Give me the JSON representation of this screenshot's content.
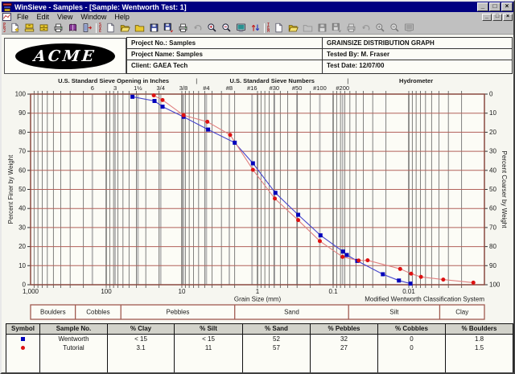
{
  "window": {
    "title": "WinSieve - Samples - [Sample: Wentworth Test: 1]",
    "controls": {
      "minimize": "_",
      "restore": "□",
      "close": "×"
    }
  },
  "menu": {
    "items": [
      "File",
      "Edit",
      "View",
      "Window",
      "Help"
    ]
  },
  "toolbar": {
    "groups": [
      {
        "label": "PRJ",
        "buttons": [
          {
            "icon": "new-project",
            "disabled": false
          },
          {
            "icon": "open-project",
            "disabled": false
          },
          {
            "icon": "save-project",
            "disabled": false
          },
          {
            "icon": "print",
            "disabled": false
          },
          {
            "icon": "help-book",
            "disabled": false
          },
          {
            "icon": "exit",
            "disabled": false
          }
        ]
      },
      {
        "label": "SVE",
        "buttons": [
          {
            "icon": "new-document",
            "disabled": false
          },
          {
            "icon": "open-folder",
            "disabled": false
          },
          {
            "icon": "closed-folder",
            "disabled": false
          },
          {
            "icon": "save",
            "disabled": false
          },
          {
            "icon": "save-as",
            "disabled": false
          },
          {
            "icon": "print",
            "disabled": false
          },
          {
            "icon": "undo",
            "disabled": true
          },
          {
            "icon": "zoom-in",
            "disabled": false
          },
          {
            "icon": "zoom-out",
            "disabled": false
          },
          {
            "icon": "print-preview",
            "disabled": false
          },
          {
            "icon": "sort",
            "disabled": false
          }
        ]
      },
      {
        "label": "TEM",
        "buttons": [
          {
            "icon": "new-document",
            "disabled": false
          },
          {
            "icon": "open-folder",
            "disabled": false
          },
          {
            "icon": "closed-folder",
            "disabled": true
          },
          {
            "icon": "save",
            "disabled": true
          },
          {
            "icon": "save-as",
            "disabled": true
          },
          {
            "icon": "print",
            "disabled": true
          },
          {
            "icon": "undo",
            "disabled": true
          },
          {
            "icon": "zoom-in",
            "disabled": true
          },
          {
            "icon": "zoom-out",
            "disabled": true
          },
          {
            "icon": "print-preview",
            "disabled": true
          }
        ]
      }
    ]
  },
  "header": {
    "logo_text": "ACME",
    "fields_left": [
      "Project No.: Samples",
      "Project Name: Samples",
      "Client: GAEA Tech"
    ],
    "fields_right": [
      "GRAINSIZE DISTRIBUTION GRAPH",
      "Tested By: M. Fraser",
      "Test Date: 12/07/00"
    ]
  },
  "chart_data": {
    "type": "line",
    "x_scale": "log",
    "x_axis_label": "Grain Size (mm)",
    "x_range_mm": [
      1000,
      0.001
    ],
    "x_tick_labels": [
      {
        "label": "1,000",
        "mm": 1000
      },
      {
        "label": "100",
        "mm": 100
      },
      {
        "label": "10",
        "mm": 10
      },
      {
        "label": "1",
        "mm": 1
      },
      {
        "label": "0.1",
        "mm": 0.1
      },
      {
        "label": "0.01",
        "mm": 0.01
      }
    ],
    "y_left_label": "Percent Finer by Weight",
    "y_right_label": "Percent Coarser by Weight",
    "y_ticks": [
      0,
      10,
      20,
      30,
      40,
      50,
      60,
      70,
      80,
      90,
      100
    ],
    "top_sections": [
      {
        "label": "U.S. Standard Sieve Opening in Inches",
        "from_mm": 1000,
        "to_mm": 6.4
      },
      {
        "label": "U.S. Standard Sieve Numbers",
        "from_mm": 6.4,
        "to_mm": 0.064
      },
      {
        "label": "Hydrometer",
        "from_mm": 0.064,
        "to_mm": 0.001
      }
    ],
    "sieve_ticks": [
      {
        "label": "6",
        "mm": 152.4
      },
      {
        "label": "3",
        "mm": 76.2
      },
      {
        "label": "1½",
        "mm": 38.1
      },
      {
        "label": "3/4",
        "mm": 19.05
      },
      {
        "label": "3/8",
        "mm": 9.53
      },
      {
        "label": "#4",
        "mm": 4.75
      },
      {
        "label": "#8",
        "mm": 2.36
      },
      {
        "label": "#16",
        "mm": 1.18
      },
      {
        "label": "#30",
        "mm": 0.6
      },
      {
        "label": "#50",
        "mm": 0.3
      },
      {
        "label": "#100",
        "mm": 0.15
      },
      {
        "label": "#200",
        "mm": 0.075
      }
    ],
    "footnote": "Modified Wentworth Classification System",
    "bands": [
      {
        "label": "Boulders",
        "from_mm": 1000,
        "to_mm": 256
      },
      {
        "label": "Cobbles",
        "from_mm": 256,
        "to_mm": 64
      },
      {
        "label": "Pebbles",
        "from_mm": 64,
        "to_mm": 2
      },
      {
        "label": "Sand",
        "from_mm": 2,
        "to_mm": 0.0625
      },
      {
        "label": "Silt",
        "from_mm": 0.0625,
        "to_mm": 0.0039
      },
      {
        "label": "Clay",
        "from_mm": 0.0039,
        "to_mm": 0.001
      }
    ],
    "grid": {
      "horizontal_color": "#b2615a",
      "vertical_color": "#4d4d4d",
      "box_color": "#8a4a40"
    },
    "series": [
      {
        "name": "Wentworth",
        "marker": "square",
        "color": "#0000bb",
        "line_color": "#4444cc",
        "points_mm_percentfiner": [
          [
            45,
            98.6
          ],
          [
            23,
            96.4
          ],
          [
            18,
            93.4
          ],
          [
            9.5,
            88.1
          ],
          [
            4.5,
            81.4
          ],
          [
            2.0,
            74.5
          ],
          [
            1.15,
            63.7
          ],
          [
            0.58,
            48.2
          ],
          [
            0.29,
            36.7
          ],
          [
            0.147,
            25.9
          ],
          [
            0.074,
            17.4
          ],
          [
            0.066,
            15.6
          ],
          [
            0.048,
            12.5
          ],
          [
            0.022,
            5.5
          ],
          [
            0.0135,
            2.2
          ],
          [
            0.0095,
            0.6
          ]
        ]
      },
      {
        "name": "Tutorial",
        "marker": "circle",
        "color": "#dd1111",
        "line_color": "#e08080",
        "points_mm_percentfiner": [
          [
            23.5,
            99.3
          ],
          [
            18,
            96.9
          ],
          [
            9.5,
            88.9
          ],
          [
            4.6,
            85.5
          ],
          [
            2.3,
            78.6
          ],
          [
            1.15,
            60.3
          ],
          [
            0.59,
            45.2
          ],
          [
            0.29,
            33.9
          ],
          [
            0.15,
            22.9
          ],
          [
            0.075,
            14.6
          ],
          [
            0.046,
            12.7
          ],
          [
            0.035,
            12.8
          ],
          [
            0.013,
            8.3
          ],
          [
            0.0093,
            5.8
          ],
          [
            0.0069,
            4.1
          ],
          [
            0.0035,
            2.7
          ],
          [
            0.0014,
            1.1
          ]
        ]
      }
    ]
  },
  "results_table": {
    "headers": [
      "Symbol",
      "Sample No.",
      "% Clay",
      "% Silt",
      "% Sand",
      "% Pebbles",
      "% Cobbles",
      "% Boulders"
    ],
    "rows": [
      {
        "symbol": {
          "shape": "square",
          "color": "#0000bb"
        },
        "sample": "Wentworth",
        "values": [
          "< 15",
          "< 15",
          "52",
          "32",
          "0",
          "1.8"
        ]
      },
      {
        "symbol": {
          "shape": "circle",
          "color": "#dd1111"
        },
        "sample": "Tutorial",
        "values": [
          "3.1",
          "11",
          "57",
          "27",
          "0",
          "1.5"
        ]
      }
    ]
  }
}
